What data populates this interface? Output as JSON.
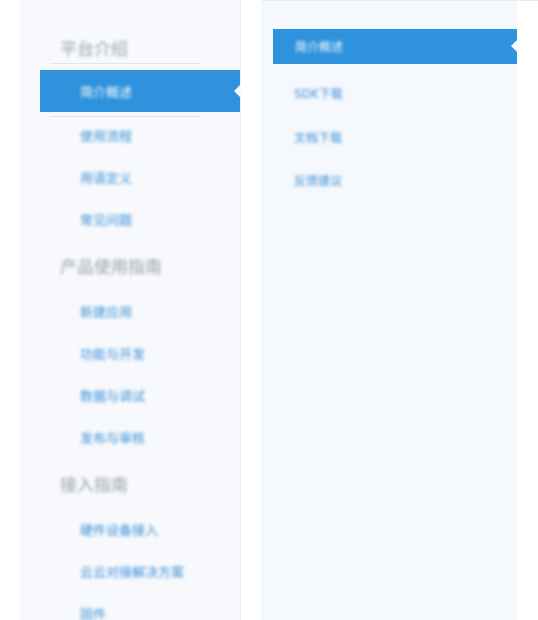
{
  "sidebar": {
    "sections": [
      {
        "title": "平台介绍",
        "items": [
          {
            "label": "简介概述",
            "active": true
          },
          {
            "label": "使用流程",
            "active": false
          },
          {
            "label": "用语定义",
            "active": false
          },
          {
            "label": "常见问题",
            "active": false
          }
        ]
      },
      {
        "title": "产品使用指南",
        "items": [
          {
            "label": "新建应用",
            "active": false
          },
          {
            "label": "功能与开发",
            "active": false
          },
          {
            "label": "数据与调试",
            "active": false
          },
          {
            "label": "发布与审核",
            "active": false
          }
        ]
      },
      {
        "title": "接入指南",
        "items": [
          {
            "label": "硬件设备接入",
            "active": false
          },
          {
            "label": "云云对接解决方案",
            "active": false
          },
          {
            "label": "固件",
            "active": false
          }
        ]
      }
    ]
  },
  "subnav": {
    "items": [
      {
        "label": "简介概述",
        "active": true
      },
      {
        "label": "SDK下载",
        "active": false
      },
      {
        "label": "文档下载",
        "active": false
      },
      {
        "label": "反馈建议",
        "active": false
      }
    ]
  },
  "colors": {
    "accent": "#2e93dc",
    "link": "#3a8fd8",
    "panel_bg": "#f7f9fc",
    "heading": "#9aa0a8"
  }
}
